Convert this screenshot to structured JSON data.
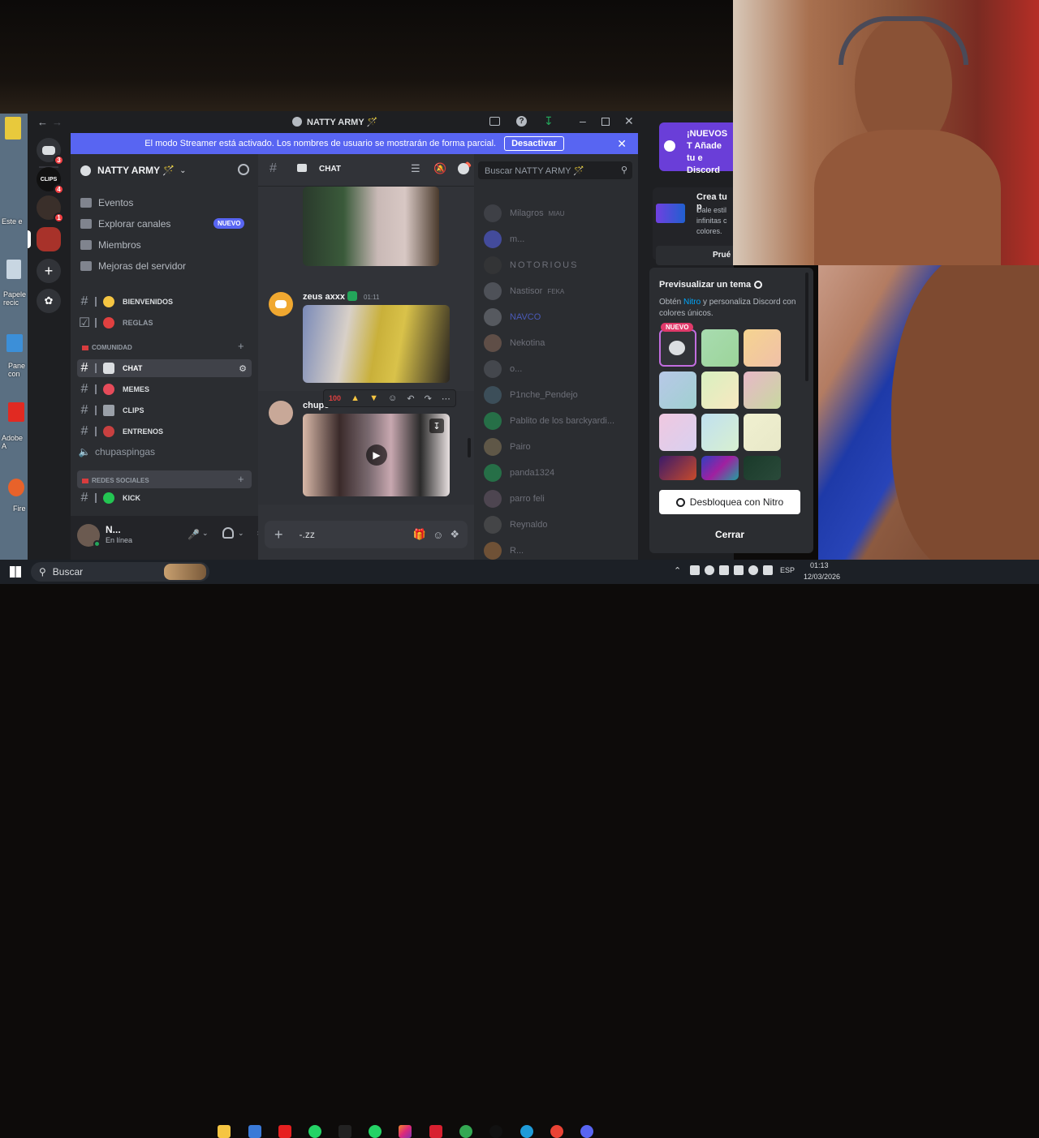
{
  "desktop": {
    "icons": [
      "Este e",
      "Papele recic",
      "Pane con",
      "Adobe A",
      "Fire"
    ]
  },
  "window": {
    "title": "NATTY ARMY 🪄",
    "back_icon": "arrow-left-icon",
    "forward_icon": "arrow-right-icon"
  },
  "streamer_banner": {
    "text": "El modo Streamer está activado. Los nombres de usuario se mostrarán de forma parcial.",
    "button": "Desactivar"
  },
  "servers": {
    "badges": [
      "3",
      "4",
      "1"
    ]
  },
  "server": {
    "name": "NATTY ARMY 🪄",
    "nav": [
      "Eventos",
      "Explorar canales",
      "Miembros",
      "Mejoras del servidor"
    ],
    "nav_badge": "NUEVO",
    "top_channels": [
      "BIENVENIDOS",
      "REGLAS"
    ],
    "category1": "COMUNIDAD",
    "community_channels": [
      "CHAT",
      "MEMES",
      "CLIPS",
      "ENTRENOS"
    ],
    "voice_channel": "chupaspingas",
    "category2": "REDES SOCIALES",
    "social_channels": [
      "KICK"
    ]
  },
  "user": {
    "name": "N...",
    "status": "En línea"
  },
  "chat": {
    "channel": "CHAT",
    "search_placeholder": "Buscar NATTY ARMY 🪄",
    "messages": [
      {
        "author": "zeus axxx",
        "time": "01:11"
      },
      {
        "author": "chupe",
        "time": ""
      }
    ],
    "composer_text": "-.zz"
  },
  "members": [
    {
      "name": "Milagros",
      "tag": "MIAU"
    },
    {
      "name": "m...",
      "tag": ""
    },
    {
      "name": "NOTORIOUS",
      "tag": ""
    },
    {
      "name": "Nastisor",
      "tag": "FEKA"
    },
    {
      "name": "NAVCO",
      "tag": ""
    },
    {
      "name": "Nekotina",
      "tag": ""
    },
    {
      "name": "o...",
      "tag": ""
    },
    {
      "name": "P1nche_Pendejo",
      "tag": ""
    },
    {
      "name": "Pablito de los barckyardi...",
      "tag": ""
    },
    {
      "name": "Pairo",
      "tag": ""
    },
    {
      "name": "panda1324",
      "tag": ""
    },
    {
      "name": "parro feli",
      "tag": ""
    },
    {
      "name": "Reynaldo",
      "tag": ""
    },
    {
      "name": "R...",
      "tag": ""
    }
  ],
  "nitro_promo": {
    "title": "¡NUEVOS T Añade tu e Discord",
    "card_title": "Crea tu p",
    "card_text": "Dale estil infinitas c colores.",
    "card_button": "Prué"
  },
  "theme_popup": {
    "title": "Previsualizar un tema",
    "text_before": "Obtén",
    "nitro_word": "Nitro",
    "text_after": "y personaliza Discord con colores únicos.",
    "new_badge": "NUEVO",
    "unlock_button": "Desbloquea con Nitro",
    "close_button": "Cerrar"
  },
  "taskbar": {
    "search": "Buscar",
    "lang": "ESP",
    "time": "01:13",
    "date": "12/03/2026"
  },
  "colors": {
    "discord_blurple": "#5865f2",
    "online_green": "#23a55a",
    "notification_red": "#f23f43"
  }
}
